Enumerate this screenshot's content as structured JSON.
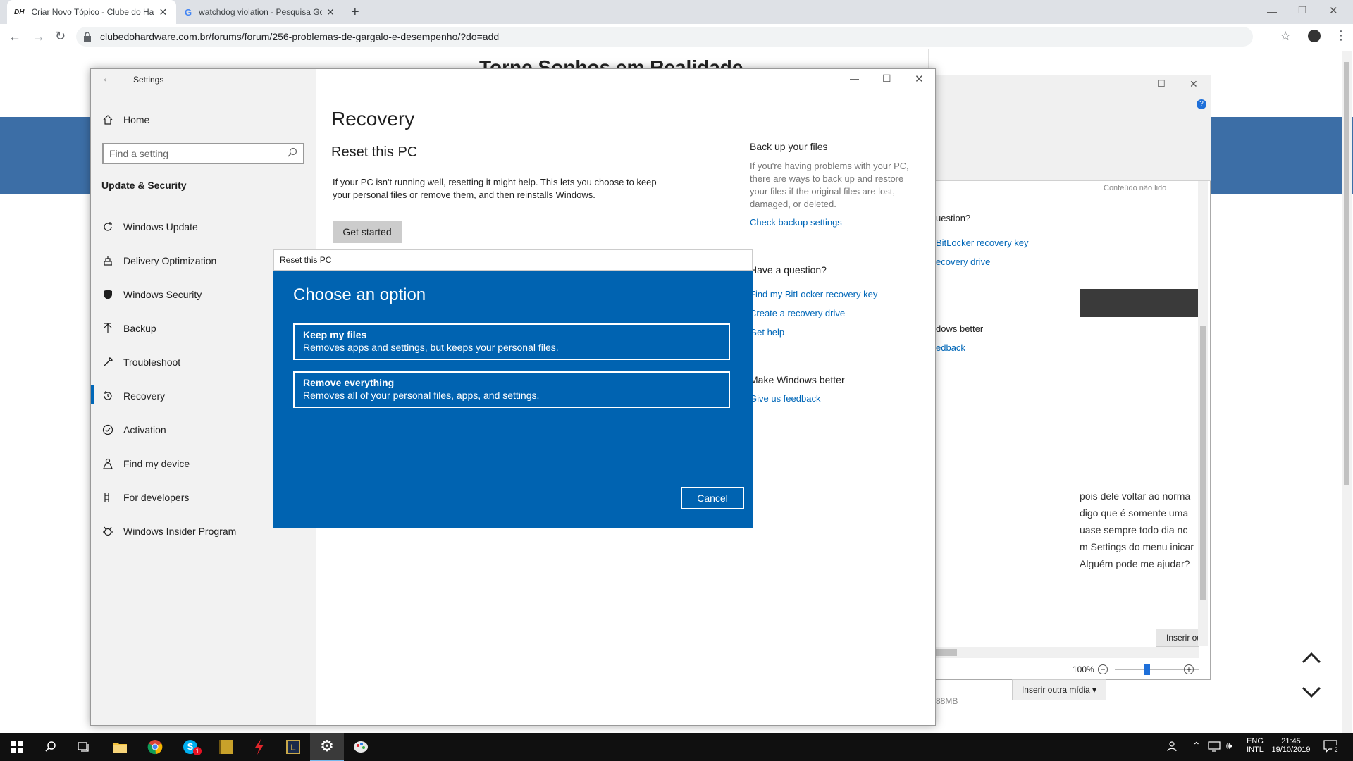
{
  "browser": {
    "tabs": [
      {
        "favicon": "DH",
        "title": "Criar Novo Tópico - Clube do Ha"
      },
      {
        "favicon": "G",
        "title": "watchdog violation - Pesquisa Go"
      }
    ],
    "url": "clubedohardware.com.br/forums/forum/256-problemas-de-gargalo-e-desempenho/?do=add"
  },
  "background_page": {
    "title": "Torne Sonhos em Realidade"
  },
  "editor_window": {
    "unread_label": "Conteúdo não lido",
    "links_partial": [
      "uestion?",
      "BitLocker recovery key",
      "ecovery drive",
      "dows better",
      "edback"
    ],
    "body_lines": [
      "pois dele voltar ao norma",
      "digo que é somente uma",
      "uase sempre todo dia nc",
      "m Settings do menu inicar",
      "Alguém pode me ajudar?"
    ],
    "insert_btn": "Inserir ou",
    "insert_media": "Inserir outra mídia",
    "size_text": "88MB",
    "zoom": "100%"
  },
  "settings": {
    "window_title": "Settings",
    "home": "Home",
    "search_placeholder": "Find a setting",
    "section": "Update & Security",
    "nav": [
      {
        "label": "Windows Update",
        "icon": "refresh-icon"
      },
      {
        "label": "Delivery Optimization",
        "icon": "delivery-icon"
      },
      {
        "label": "Windows Security",
        "icon": "shield-icon"
      },
      {
        "label": "Backup",
        "icon": "backup-icon"
      },
      {
        "label": "Troubleshoot",
        "icon": "wrench-icon"
      },
      {
        "label": "Recovery",
        "icon": "recovery-icon"
      },
      {
        "label": "Activation",
        "icon": "activation-icon"
      },
      {
        "label": "Find my device",
        "icon": "find-device-icon"
      },
      {
        "label": "For developers",
        "icon": "developer-icon"
      },
      {
        "label": "Windows Insider Program",
        "icon": "insider-icon"
      }
    ],
    "selected": "Recovery",
    "page_title": "Recovery",
    "reset_title": "Reset this PC",
    "reset_desc": "If your PC isn't running well, resetting it might help. This lets you choose to keep your personal files or remove them, and then reinstalls Windows.",
    "get_started": "Get started",
    "right": {
      "backup_title": "Back up your files",
      "backup_desc": "If you're having problems with your PC, there are ways to back up and restore your files if the original files are lost, damaged, or deleted.",
      "backup_link": "Check backup settings",
      "question_title": "Have a question?",
      "links": [
        "Find my BitLocker recovery key",
        "Create a recovery drive",
        "Get help"
      ],
      "better_title": "Make Windows better",
      "feedback_link": "Give us feedback"
    }
  },
  "dialog": {
    "title": "Reset this PC",
    "heading": "Choose an option",
    "options": [
      {
        "title": "Keep my files",
        "desc": "Removes apps and settings, but keeps your personal files."
      },
      {
        "title": "Remove everything",
        "desc": "Removes all of your personal files, apps, and settings."
      }
    ],
    "cancel": "Cancel"
  },
  "taskbar": {
    "lang1": "ENG",
    "lang2": "INTL",
    "time": "21:45",
    "date": "19/10/2019",
    "skype_badge": "1",
    "notifications": "2"
  },
  "colors": {
    "dialog_blue": "#0063b1",
    "link_blue": "#0067b8",
    "sidebar": "#f2f2f2",
    "taskbar": "#101010",
    "site_banner": "#3c6ea6"
  }
}
